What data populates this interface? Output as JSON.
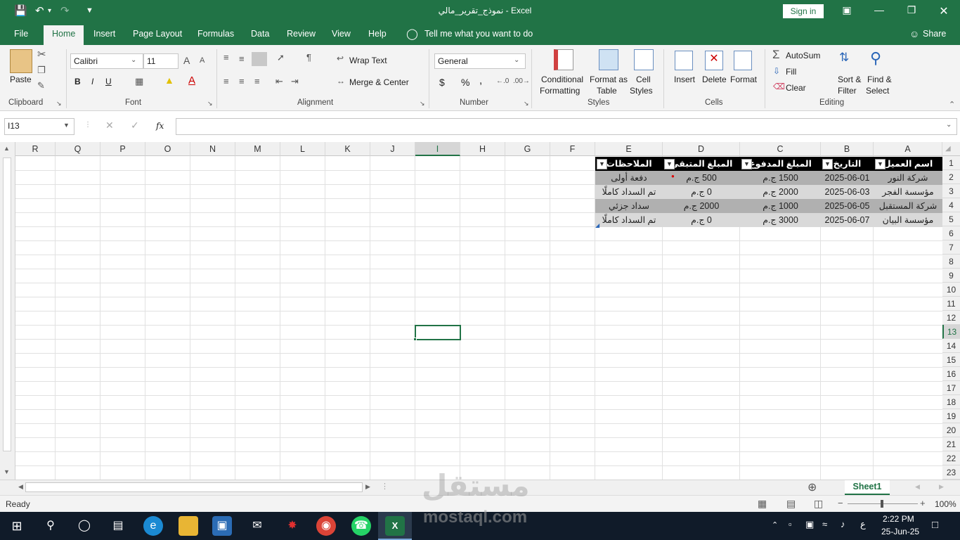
{
  "window": {
    "title": "نموذج_تقرير_مالي  -  Excel",
    "sign_in": "Sign in"
  },
  "tabs": [
    "File",
    "Home",
    "Insert",
    "Page Layout",
    "Formulas",
    "Data",
    "Review",
    "View",
    "Help"
  ],
  "tell_me": "Tell me what you want to do",
  "share": "Share",
  "ribbon": {
    "clipboard": {
      "paste": "Paste",
      "label": "Clipboard"
    },
    "font": {
      "name": "Calibri",
      "size": "11",
      "bold": "B",
      "italic": "I",
      "underline": "U",
      "label": "Font"
    },
    "alignment": {
      "wrap_text": "Wrap Text",
      "merge_center": "Merge & Center",
      "label": "Alignment"
    },
    "number": {
      "format": "General",
      "currency": "$",
      "percent": "%",
      "comma": ",",
      "label": "Number"
    },
    "styles": {
      "conditional_1": "Conditional",
      "conditional_2": "Formatting",
      "format_as_1": "Format as",
      "format_as_2": "Table",
      "cell_1": "Cell",
      "cell_2": "Styles",
      "label": "Styles"
    },
    "cells": {
      "insert": "Insert",
      "delete": "Delete",
      "format": "Format",
      "label": "Cells"
    },
    "editing": {
      "autosum": "AutoSum",
      "fill": "Fill",
      "clear": "Clear",
      "sort_1": "Sort &",
      "sort_2": "Filter",
      "find_1": "Find &",
      "find_2": "Select",
      "label": "Editing"
    }
  },
  "formula_bar": {
    "name_box": "I13",
    "fx": "fx",
    "formula": ""
  },
  "columns": [
    "A",
    "B",
    "C",
    "D",
    "E",
    "F",
    "G",
    "H",
    "I",
    "J",
    "K",
    "L",
    "M",
    "N",
    "O",
    "P",
    "Q",
    "R"
  ],
  "selected_column": "I",
  "selected_row": "13",
  "rows": [
    "1",
    "2",
    "3",
    "4",
    "5",
    "6",
    "7",
    "8",
    "9",
    "10",
    "11",
    "12",
    "13",
    "14",
    "15",
    "16",
    "17",
    "18",
    "19",
    "20",
    "21",
    "22",
    "23"
  ],
  "table": {
    "headers": [
      "اسم العميل",
      "التاريخ",
      "المبلغ المدفوع",
      "المبلغ المتبقي",
      "الملاحظات"
    ],
    "rows": [
      [
        "شركة النور",
        "2025-06-01",
        "1500 ج.م",
        "500 ج.م",
        "دفعة أولى"
      ],
      [
        "مؤسسة الفجر",
        "2025-06-03",
        "2000 ج.م",
        "0 ج.م",
        "تم السداد كاملًا"
      ],
      [
        "شركة المستقبل",
        "2025-06-05",
        "1000 ج.م",
        "2000 ج.م",
        "سداد جزئي"
      ],
      [
        "مؤسسة البيان",
        "2025-06-07",
        "3000 ج.م",
        "0 ج.م",
        "تم السداد كاملًا"
      ]
    ]
  },
  "sheet_tab": "Sheet1",
  "status": {
    "ready": "Ready",
    "zoom": "100%"
  },
  "watermark": {
    "arabic": "مستقل",
    "latin": "mostaql.com"
  },
  "taskbar": {
    "lang": "ع",
    "time": "2:22 PM",
    "date": "25-Jun-25"
  },
  "colors": {
    "excel_green": "#217346",
    "header_black": "#000000",
    "row_dark": "#b0b0b0",
    "row_light": "#d9d9d9",
    "taskbar": "#101b29"
  }
}
